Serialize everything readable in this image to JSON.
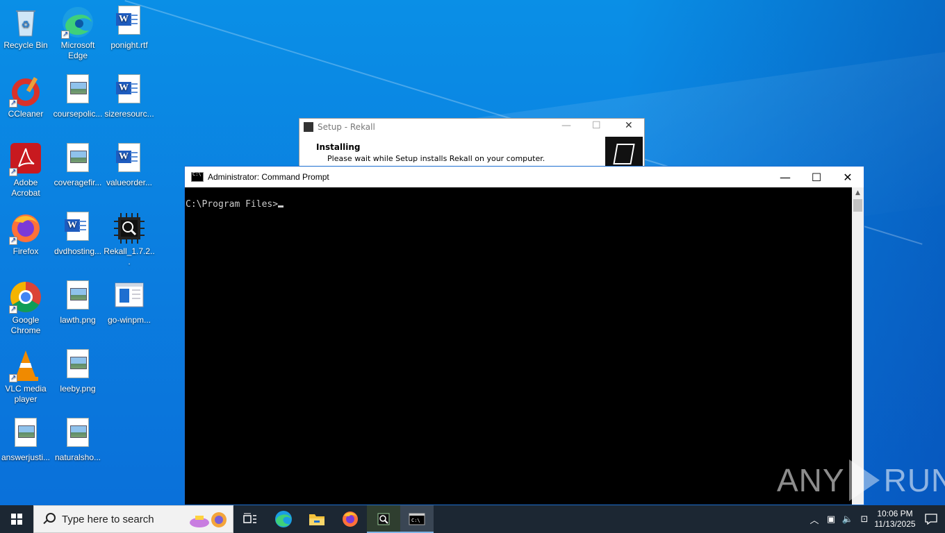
{
  "desktop": {
    "icons": [
      {
        "label": "Recycle Bin",
        "icon": "recycle-bin-icon"
      },
      {
        "label": "Microsoft Edge",
        "icon": "edge-icon"
      },
      {
        "label": "ponight.rtf",
        "icon": "word-doc-icon"
      },
      {
        "label": "CCleaner",
        "icon": "ccleaner-icon"
      },
      {
        "label": "coursepolic...",
        "icon": "image-file-icon"
      },
      {
        "label": "sizeresourc...",
        "icon": "word-doc-icon"
      },
      {
        "label": "Adobe Acrobat",
        "icon": "acrobat-icon"
      },
      {
        "label": "coveragefir...",
        "icon": "image-file-icon"
      },
      {
        "label": "valueorder...",
        "icon": "word-doc-icon"
      },
      {
        "label": "Firefox",
        "icon": "firefox-icon"
      },
      {
        "label": "dvdhosting...",
        "icon": "word-doc-icon"
      },
      {
        "label": "Rekall_1.7.2...",
        "icon": "rekall-installer-icon"
      },
      {
        "label": "Google Chrome",
        "icon": "chrome-icon"
      },
      {
        "label": "lawth.png",
        "icon": "image-file-icon"
      },
      {
        "label": "go-winpm...",
        "icon": "window-file-icon"
      },
      {
        "label": "VLC media player",
        "icon": "vlc-icon"
      },
      {
        "label": "leeby.png",
        "icon": "image-file-icon"
      },
      {
        "label": "answerjusti...",
        "icon": "image-file-icon"
      },
      {
        "label": "naturalsho...",
        "icon": "image-file-icon"
      }
    ]
  },
  "setup_window": {
    "title": "Setup - Rekall",
    "heading": "Installing",
    "subtext": "Please wait while Setup installs Rekall on your computer.",
    "minimize": "—",
    "maximize": "☐",
    "close": "✕"
  },
  "cmd_window": {
    "title": "Administrator: Command Prompt",
    "minimize": "—",
    "maximize": "☐",
    "close": "✕",
    "prompt": "C:\\Program Files>"
  },
  "watermark": {
    "left": "ANY",
    "right": "RUN"
  },
  "taskbar": {
    "search_placeholder": "Type here to search",
    "apps": [
      "task-view-icon",
      "edge-icon",
      "file-explorer-icon",
      "firefox-icon",
      "rekall-installer-icon",
      "cmd-icon"
    ],
    "time": "10:06 PM",
    "date": "11/13/2025"
  },
  "colors": {
    "desktop": "#0b7fe0",
    "taskbar": "#1c2733",
    "console_bg": "#000000",
    "console_fg": "#cccccc"
  }
}
